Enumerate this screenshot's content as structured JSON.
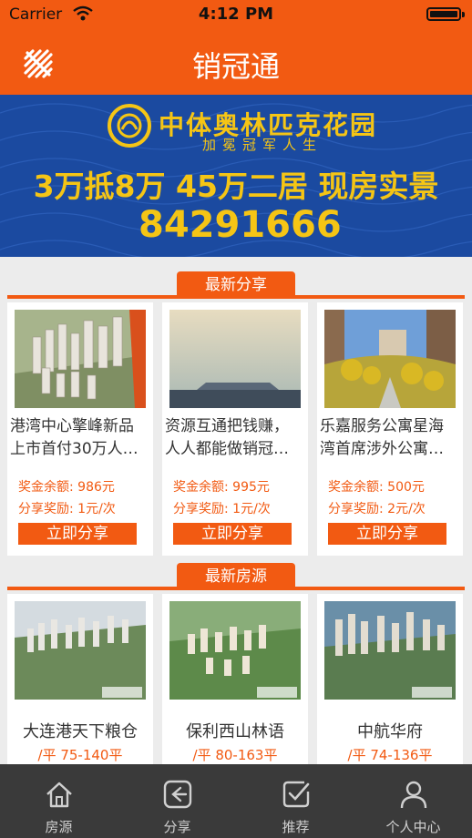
{
  "status_bar": {
    "carrier": "Carrier",
    "time": "4:12 PM"
  },
  "navbar": {
    "title": "销冠通",
    "menu_icon": "logo-menu-icon"
  },
  "banner": {
    "brand": "中体奥林匹克花园",
    "slogan": "加冕冠军人生",
    "promo": "3万抵8万 45万二居 现房实景",
    "phone": "84291666"
  },
  "share_section": {
    "title": "最新分享",
    "cards": [
      {
        "line1": "港湾中心擎峰新品",
        "line2": "上市首付30万人…",
        "bonus_label": "奖金余额:",
        "bonus": "986元",
        "reward_label": "分享奖励:",
        "reward": "1元/次",
        "button": "立即分享"
      },
      {
        "line1": "资源互通把钱赚，",
        "line2": "人人都能做销冠…",
        "bonus_label": "奖金余额:",
        "bonus": "995元",
        "reward_label": "分享奖励:",
        "reward": "1元/次",
        "button": "立即分享"
      },
      {
        "line1": "乐嘉服务公寓星海",
        "line2": "湾首席涉外公寓…",
        "bonus_label": "奖金余额:",
        "bonus": "500元",
        "reward_label": "分享奖励:",
        "reward": "2元/次",
        "button": "立即分享"
      }
    ]
  },
  "listing_section": {
    "title": "最新房源",
    "cards": [
      {
        "name": "大连港天下粮仓",
        "price": "/平 75-140平"
      },
      {
        "name": "保利西山林语",
        "price": "/平 80-163平"
      },
      {
        "name": "中航华府",
        "price": "/平 74-136平"
      }
    ]
  },
  "tabbar": {
    "tabs": [
      {
        "label": "房源",
        "icon": "house-icon"
      },
      {
        "label": "分享",
        "icon": "share-arrow-icon"
      },
      {
        "label": "推荐",
        "icon": "check-note-icon"
      },
      {
        "label": "个人中心",
        "icon": "person-icon"
      }
    ]
  },
  "colors": {
    "accent": "#f25a12",
    "banner_bg": "#1b4aa0",
    "banner_text": "#f5c515",
    "tabbar_bg": "#3a3a3a"
  }
}
